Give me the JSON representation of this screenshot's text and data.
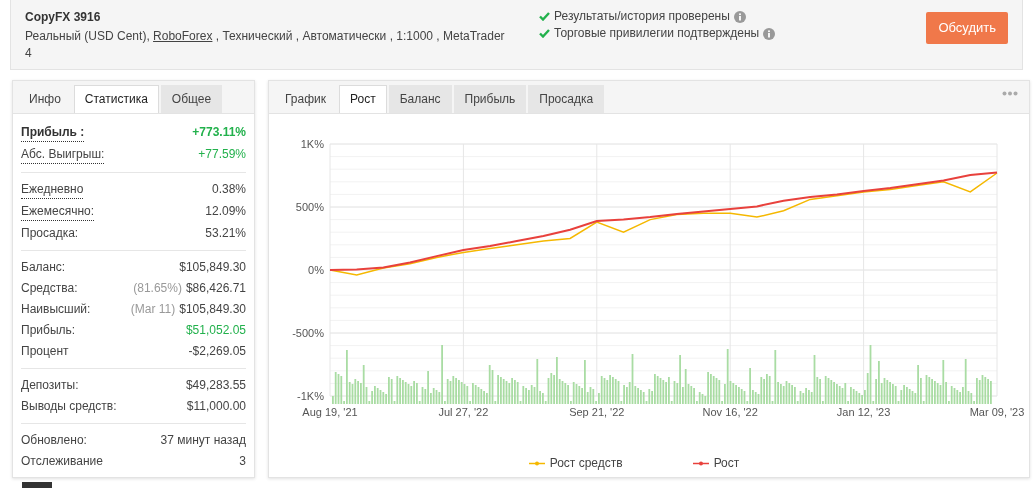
{
  "header": {
    "title": "CopyFX 3916",
    "subtitle_before": "Реальный (USD Cent), ",
    "broker_link": "RoboForex",
    "subtitle_after": " , Технический , Автоматически , 1:1000 , MetaTrader 4",
    "checks": [
      {
        "text": "Результаты/история проверены",
        "verified": true
      },
      {
        "text": "Торговые привилегии подтверждены",
        "verified": true
      }
    ],
    "button": "Обсудить"
  },
  "stats": {
    "tabs": [
      {
        "label": "Инфо",
        "selected": false
      },
      {
        "label": "Статистика",
        "selected": true
      },
      {
        "label": "Общее",
        "selected": false
      }
    ],
    "groups": [
      [
        {
          "label": "Прибыль :",
          "value": "+773.11%",
          "green": true,
          "dotted": true,
          "bold": true
        },
        {
          "label": "Абс. Выигрыш:",
          "value": "+77.59%",
          "green": true,
          "dotted": true,
          "bold": false
        }
      ],
      [
        {
          "label": "Ежедневно",
          "value": "0.38%",
          "green": false,
          "dotted": true,
          "bold": false
        },
        {
          "label": "Ежемесячно:",
          "value": "12.09%",
          "green": false,
          "dotted": true,
          "bold": false
        },
        {
          "label": "Просадка:",
          "value": "53.21%",
          "green": false,
          "dotted": false,
          "bold": false
        }
      ],
      [
        {
          "label": "Баланс:",
          "value": "$105,849.30",
          "green": false,
          "dotted": false,
          "bold": false
        },
        {
          "label": "Средства:",
          "note": "(81.65%)",
          "value": "$86,426.71",
          "green": false,
          "dotted": false,
          "bold": false
        },
        {
          "label": "Наивысший:",
          "note": "(Mar 11)",
          "value": "$105,849.30",
          "green": false,
          "dotted": false,
          "bold": false
        },
        {
          "label": "Прибыль:",
          "value": "$51,052.05",
          "green": true,
          "dotted": false,
          "bold": false
        },
        {
          "label": "Процент",
          "value": "-$2,269.05",
          "green": false,
          "dotted": false,
          "bold": false
        }
      ],
      [
        {
          "label": "Депозиты:",
          "value": "$49,283.55",
          "green": false,
          "dotted": false,
          "bold": false
        },
        {
          "label": "Выводы средств:",
          "value": "$11,000.00",
          "green": false,
          "dotted": false,
          "bold": false
        }
      ],
      [
        {
          "label": "Обновлено:",
          "value": "37 минут назад",
          "green": false,
          "dotted": false,
          "bold": false
        },
        {
          "label": "Отслеживание",
          "value": "3",
          "green": false,
          "dotted": false,
          "bold": false
        }
      ]
    ]
  },
  "chart_panel": {
    "tabs": [
      {
        "label": "График",
        "selected": false
      },
      {
        "label": "Рост",
        "selected": true
      },
      {
        "label": "Баланс",
        "selected": false
      },
      {
        "label": "Прибыль",
        "selected": false
      },
      {
        "label": "Просадка",
        "selected": false
      }
    ],
    "chart_data": {
      "type": "line",
      "categories": [
        "Aug 19, '21",
        null,
        null,
        null,
        null,
        "Jul 27, '22",
        null,
        null,
        null,
        null,
        "Sep 21, '22",
        null,
        null,
        null,
        null,
        "Nov 16, '22",
        null,
        null,
        null,
        null,
        "Jan 12, '23",
        null,
        null,
        null,
        null,
        "Mar 09, '23"
      ],
      "ylim": [
        -1000,
        1000
      ],
      "grid": true,
      "yticks": [
        {
          "value": 1000,
          "label": "1K%"
        },
        {
          "value": 500,
          "label": "500%"
        },
        {
          "value": 0,
          "label": "0%"
        },
        {
          "value": -500,
          "label": "-500%"
        },
        {
          "value": -1000,
          "label": "-1K%"
        }
      ],
      "series": [
        {
          "name": "Рост средств",
          "color": "#f5b800",
          "values": [
            0,
            -40,
            15,
            50,
            100,
            140,
            170,
            200,
            230,
            250,
            380,
            300,
            400,
            440,
            450,
            450,
            420,
            470,
            560,
            590,
            620,
            640,
            670,
            700,
            620,
            770
          ]
        },
        {
          "name": "Рост",
          "color": "#e8413c",
          "values": [
            0,
            5,
            20,
            60,
            110,
            159,
            190,
            230,
            270,
            320,
            389,
            400,
            420,
            445,
            465,
            484,
            505,
            550,
            580,
            600,
            627,
            650,
            680,
            710,
            755,
            773
          ]
        }
      ]
    }
  }
}
